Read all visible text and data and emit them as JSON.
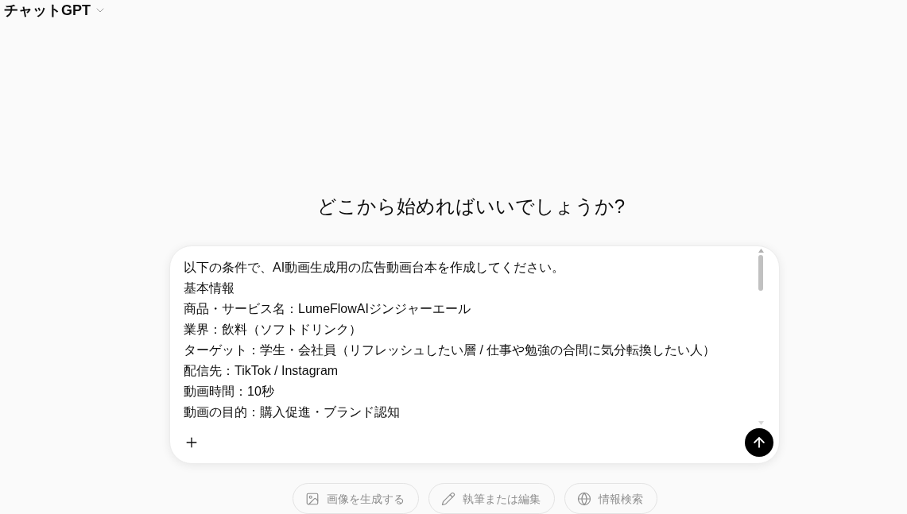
{
  "header": {
    "title": "チャットGPT"
  },
  "heading": "どこから始めればいいでしょうか?",
  "composer": {
    "lines": [
      "以下の条件で、AI動画生成用の広告動画台本を作成してください。",
      "基本情報",
      "商品・サービス名：LumeFlowAIジンジャーエール",
      "業界：飲料（ソフトドリンク）",
      "ターゲット：学生・会社員（リフレッシュしたい層 / 仕事や勉強の合間に気分転換したい人）",
      "配信先：TikTok / Instagram",
      "動画時間：10秒",
      "動画の目的：購入促進・ブランド認知"
    ]
  },
  "suggestions": [
    {
      "kind": "image",
      "label": "画像を生成する"
    },
    {
      "kind": "write",
      "label": "執筆または編集"
    },
    {
      "kind": "search",
      "label": "情報検索"
    }
  ]
}
